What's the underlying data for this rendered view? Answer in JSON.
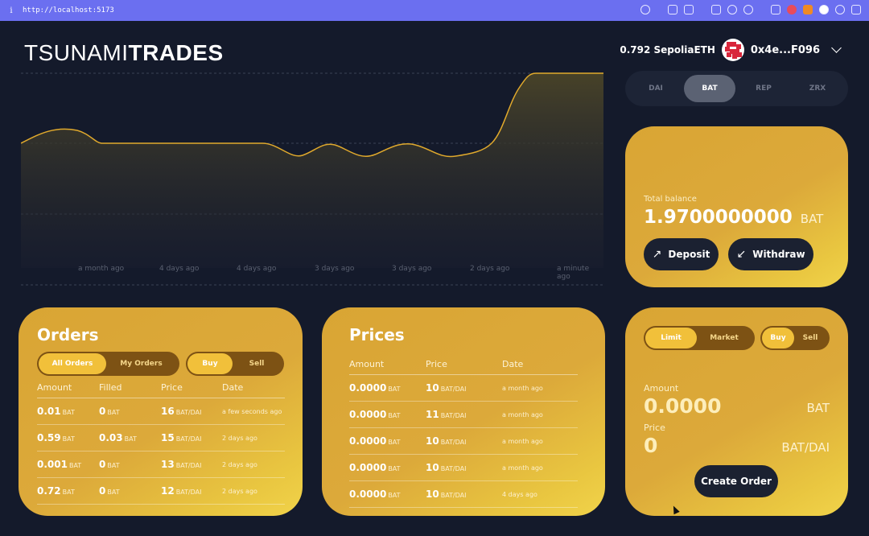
{
  "browser": {
    "url": "http://localhost:5173"
  },
  "logo": {
    "light": "TSUNAMI",
    "bold": "TRADES"
  },
  "account": {
    "eth_balance": "0.792 SepoliaETH",
    "address": "0x4e...F096"
  },
  "chart": {
    "x_ticks": [
      "a month ago",
      "4 days ago",
      "4 days ago",
      "3 days ago",
      "3 days ago",
      "2 days ago",
      "a minute ago"
    ],
    "colors": {
      "line": "#e0a92c",
      "fill": "#3b3826",
      "grid": "#3a4156"
    }
  },
  "tokens": [
    "DAI",
    "BAT",
    "REP",
    "ZRX"
  ],
  "active_token": "BAT",
  "balance": {
    "label": "Total balance",
    "amount": "1.9700000000",
    "unit": "BAT",
    "deposit": "Deposit",
    "withdraw": "Withdraw"
  },
  "orders": {
    "title": "Orders",
    "filter_tabs": [
      "All Orders",
      "My Orders"
    ],
    "side_tabs": [
      "Buy",
      "Sell"
    ],
    "headers": [
      "Amount",
      "Filled",
      "Price",
      "Date"
    ],
    "rows": [
      {
        "amount": "0.01",
        "amount_unit": "BAT",
        "filled": "0",
        "filled_unit": "BAT",
        "price": "16",
        "price_unit": "BAT/DAI",
        "date": "a few seconds ago"
      },
      {
        "amount": "0.59",
        "amount_unit": "BAT",
        "filled": "0.03",
        "filled_unit": "BAT",
        "price": "15",
        "price_unit": "BAT/DAI",
        "date": "2 days ago"
      },
      {
        "amount": "0.001",
        "amount_unit": "BAT",
        "filled": "0",
        "filled_unit": "BAT",
        "price": "13",
        "price_unit": "BAT/DAI",
        "date": "2 days ago"
      },
      {
        "amount": "0.72",
        "amount_unit": "BAT",
        "filled": "0",
        "filled_unit": "BAT",
        "price": "12",
        "price_unit": "BAT/DAI",
        "date": "2 days ago"
      }
    ]
  },
  "prices": {
    "title": "Prices",
    "headers": [
      "Amount",
      "Price",
      "Date"
    ],
    "rows": [
      {
        "amount": "0.0000",
        "amount_unit": "BAT",
        "price": "10",
        "price_unit": "BAT/DAI",
        "date": "a month ago"
      },
      {
        "amount": "0.0000",
        "amount_unit": "BAT",
        "price": "11",
        "price_unit": "BAT/DAI",
        "date": "a month ago"
      },
      {
        "amount": "0.0000",
        "amount_unit": "BAT",
        "price": "10",
        "price_unit": "BAT/DAI",
        "date": "a month ago"
      },
      {
        "amount": "0.0000",
        "amount_unit": "BAT",
        "price": "10",
        "price_unit": "BAT/DAI",
        "date": "a month ago"
      },
      {
        "amount": "0.0000",
        "amount_unit": "BAT",
        "price": "10",
        "price_unit": "BAT/DAI",
        "date": "4 days ago"
      }
    ]
  },
  "order_form": {
    "type_tabs": [
      "Limit",
      "Market"
    ],
    "side_tabs": [
      "Buy",
      "Sell"
    ],
    "amount_label": "Amount",
    "amount_value": "0.0000",
    "amount_unit": "BAT",
    "price_label": "Price",
    "price_value": "0",
    "price_unit": "BAT/DAI",
    "submit": "Create Order"
  }
}
